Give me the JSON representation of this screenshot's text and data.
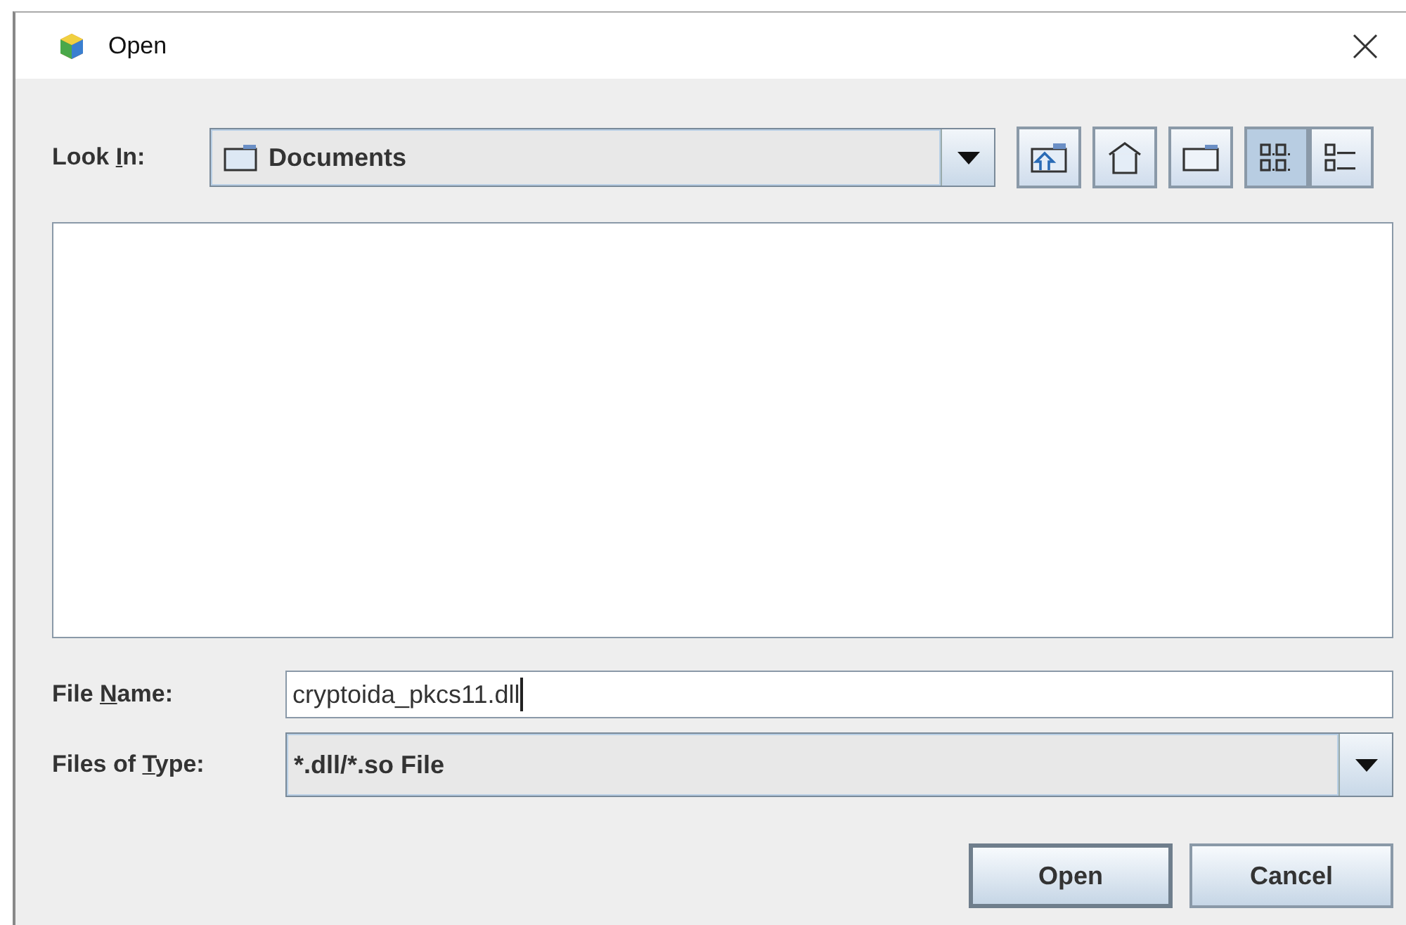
{
  "window": {
    "title": "Open"
  },
  "look_in": {
    "label": {
      "before": "Look ",
      "mnemonic": "I",
      "after": "n:"
    },
    "value": "Documents"
  },
  "toolbar": [
    {
      "kind": "up"
    },
    {
      "kind": "home"
    },
    {
      "kind": "new-folder"
    },
    {
      "kind": "list-view",
      "selected": true
    },
    {
      "kind": "details-view",
      "selected": false
    }
  ],
  "file_name": {
    "label": {
      "before": "File ",
      "mnemonic": "N",
      "after": "ame:"
    },
    "value": "cryptoida_pkcs11.dll"
  },
  "file_type": {
    "label": {
      "before": "Files of ",
      "mnemonic": "T",
      "after": "ype:"
    },
    "value": "*.dll/*.so File"
  },
  "buttons": [
    {
      "label": "Open",
      "kind": "default"
    },
    {
      "label": "Cancel",
      "kind": "normal"
    }
  ]
}
